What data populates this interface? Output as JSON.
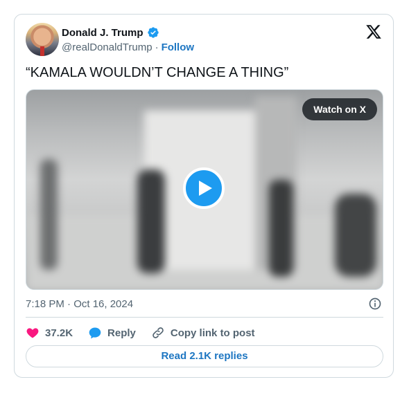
{
  "author": {
    "name": "Donald J. Trump",
    "handle": "@realDonaldTrump",
    "separator": "·",
    "follow_label": "Follow"
  },
  "tweet": {
    "text": "“KAMALA WOULDN’T CHANGE A THING”",
    "timestamp": "7:18 PM · Oct 16, 2024"
  },
  "media": {
    "watch_label": "Watch on X"
  },
  "actions": {
    "likes": "37.2K",
    "reply_label": "Reply",
    "copy_label": "Copy link to post"
  },
  "footer": {
    "replies_label": "Read 2.1K replies"
  },
  "colors": {
    "accent": "#1d9bf0",
    "like": "#f91880",
    "link": "#1d76c2"
  }
}
